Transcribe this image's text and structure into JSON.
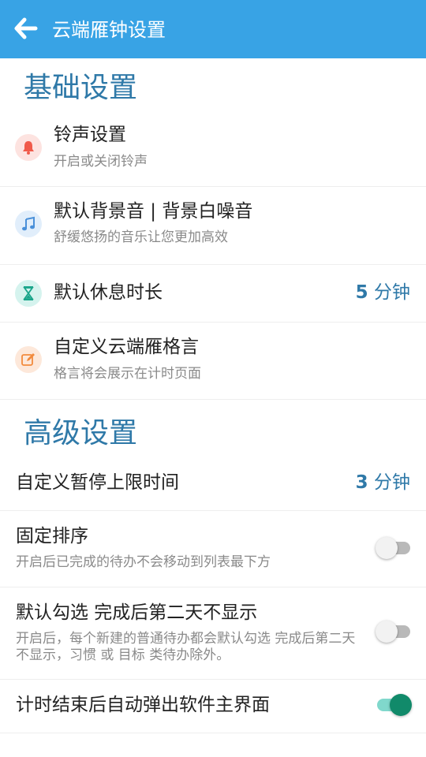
{
  "appbar": {
    "title": "云端雁钟设置",
    "back_icon": "arrow-left-icon"
  },
  "sections": {
    "basic": {
      "title": "基础设置",
      "items": [
        {
          "title": "铃声设置",
          "subtitle": "开启或关闭铃声",
          "icon": "bell-icon",
          "icon_color": "#f05a4a",
          "icon_bg": "#fde3e0"
        },
        {
          "title": "默认背景音 | 背景白噪音",
          "subtitle": "舒缓悠扬的音乐让您更加高效",
          "icon": "music-note-icon",
          "icon_color": "#4a90d9",
          "icon_bg": "#e1eefb"
        },
        {
          "title": "默认休息时长",
          "value_num": "5",
          "value_unit": " 分钟",
          "icon": "hourglass-icon",
          "icon_color": "#1aa58a",
          "icon_bg": "#d5f3ee"
        },
        {
          "title": "自定义云端雁格言",
          "subtitle": "格言将会展示在计时页面",
          "icon": "edit-icon",
          "icon_color": "#f28a3c",
          "icon_bg": "#fde8da"
        }
      ]
    },
    "advanced": {
      "title": "高级设置",
      "items": [
        {
          "title": "自定义暂停上限时间",
          "value_num": "3",
          "value_unit": " 分钟"
        },
        {
          "title": "固定排序",
          "subtitle": "开启后已完成的待办不会移动到列表最下方",
          "toggle_on": false
        },
        {
          "title": "默认勾选 完成后第二天不显示",
          "subtitle": "开启后，每个新建的普通待办都会默认勾选 完成后第二天不显示，习惯 或 目标 类待办除外。",
          "toggle_on": false
        },
        {
          "title": "计时结束后自动弹出软件主界面",
          "toggle_on": true
        }
      ]
    }
  },
  "colors": {
    "appbar": "#38a3e5",
    "section_title": "#2f79a8",
    "value": "#2f79a8",
    "toggle_on": "#118a6a"
  }
}
